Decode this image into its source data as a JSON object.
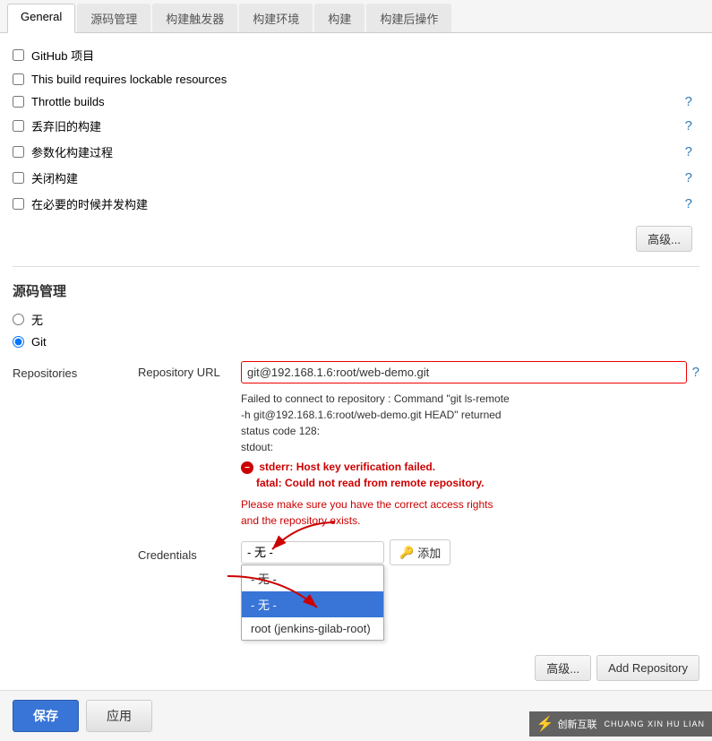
{
  "tabs": [
    {
      "label": "General",
      "active": true
    },
    {
      "label": "源码管理",
      "active": false
    },
    {
      "label": "构建触发器",
      "active": false
    },
    {
      "label": "构建环境",
      "active": false
    },
    {
      "label": "构建",
      "active": false
    },
    {
      "label": "构建后操作",
      "active": false
    }
  ],
  "checkboxes": [
    {
      "label": "GitHub 项目",
      "checked": false,
      "has_help": false
    },
    {
      "label": "This build requires lockable resources",
      "checked": false,
      "has_help": false
    },
    {
      "label": "Throttle builds",
      "checked": false,
      "has_help": true
    },
    {
      "label": "丢弃旧的构建",
      "checked": false,
      "has_help": true
    },
    {
      "label": "参数化构建过程",
      "checked": false,
      "has_help": true
    },
    {
      "label": "关闭构建",
      "checked": false,
      "has_help": true
    },
    {
      "label": "在必要的时候并发构建",
      "checked": false,
      "has_help": true
    }
  ],
  "advanced_button": "高级...",
  "source_section_title": "源码管理",
  "radio_none": "无",
  "radio_git": "Git",
  "repositories_label": "Repositories",
  "repository_url_label": "Repository URL",
  "repository_url_value": "git@192.168.1.6:root/web-demo.git",
  "error_text1": "Failed to connect to repository : Command \"git ls-remote",
  "error_text2": "-h git@192.168.1.6:root/web-demo.git HEAD\" returned",
  "error_text3": "status code 128:",
  "error_text4": "stdout:",
  "error_text5": "stderr: Host key verification failed.",
  "error_text6": "fatal: Could not read from remote repository.",
  "error_text7": "",
  "error_text8": "Please make sure you have the correct access rights",
  "error_text9": "and the repository exists.",
  "credentials_label": "Credentials",
  "credentials_placeholder": "- 无 -",
  "credentials_options": [
    {
      "value": "none",
      "label": "- 无 -",
      "selected": false
    },
    {
      "value": "none2",
      "label": "- 无 -",
      "selected": true
    },
    {
      "value": "root",
      "label": "root (jenkins-gilab-root)",
      "selected": false
    }
  ],
  "add_credential_label": "添加",
  "advanced_repo_button": "高级...",
  "add_repo_button": "Add Repository",
  "save_button": "保存",
  "apply_button": "应用",
  "watermark_text": "创新互联",
  "watermark_url_text": "CHUANG XIN HU LIAN",
  "help_icon": "ℹ"
}
